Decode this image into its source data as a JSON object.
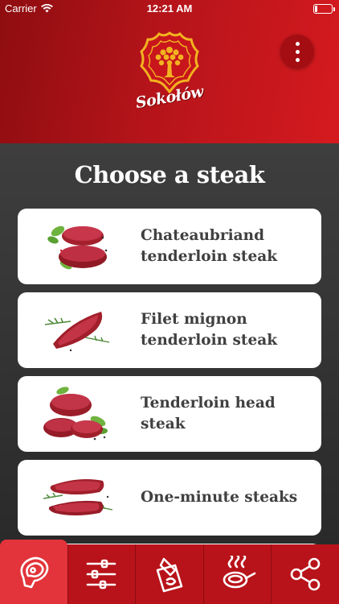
{
  "status_bar": {
    "carrier": "Carrier",
    "time": "12:21 AM"
  },
  "header": {
    "brand": "Sokołów",
    "menu_icon": "more-vertical-icon"
  },
  "colors": {
    "header_red": "#b4141a",
    "tab_red": "#b8131a",
    "tab_active": "#e2343a",
    "card_text": "#404040"
  },
  "main": {
    "title": "Choose a steak",
    "steaks": [
      {
        "name": "Chateaubriand tenderloin steak"
      },
      {
        "name": "Filet mignon tenderloin steak"
      },
      {
        "name": "Tenderloin head steak"
      },
      {
        "name": "One-minute steaks"
      }
    ]
  },
  "tabbar": {
    "active_index": 0,
    "tabs": [
      {
        "icon": "steak-icon"
      },
      {
        "icon": "sliders-icon"
      },
      {
        "icon": "cutting-board-icon"
      },
      {
        "icon": "frying-pan-icon"
      },
      {
        "icon": "share-icon"
      }
    ]
  }
}
